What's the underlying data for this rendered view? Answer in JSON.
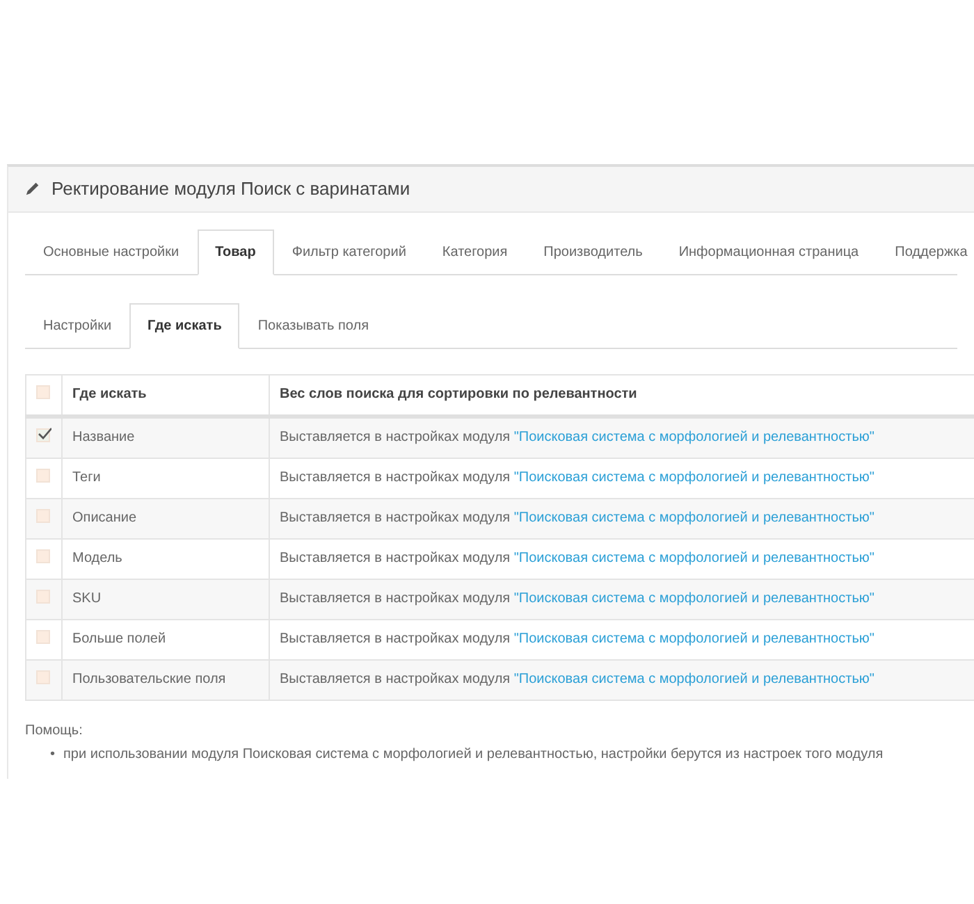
{
  "panel": {
    "title": "Ректирование модуля Поиск с варинатами"
  },
  "tabs": [
    {
      "label": "Основные настройки",
      "selected": false
    },
    {
      "label": "Товар",
      "selected": true
    },
    {
      "label": "Фильтр категорий",
      "selected": false
    },
    {
      "label": "Категория",
      "selected": false
    },
    {
      "label": "Производитель",
      "selected": false
    },
    {
      "label": "Информационная страница",
      "selected": false
    },
    {
      "label": "Поддержка",
      "selected": false
    }
  ],
  "subtabs": [
    {
      "label": "Настройки",
      "selected": false
    },
    {
      "label": "Где искать",
      "selected": true
    },
    {
      "label": "Показывать поля",
      "selected": false
    }
  ],
  "table": {
    "header_checked": false,
    "columns": [
      "Где искать",
      "Вес слов поиска для сортировки по релевантности"
    ],
    "rows": [
      {
        "checked": true,
        "name": "Название",
        "weight_text": "Выставляется в настройках модуля",
        "weight_link": "\"Поисковая система с морфологией и релевантностью\""
      },
      {
        "checked": false,
        "name": "Теги",
        "weight_text": "Выставляется в настройках модуля",
        "weight_link": "\"Поисковая система с морфологией и релевантностью\""
      },
      {
        "checked": false,
        "name": "Описание",
        "weight_text": "Выставляется в настройках модуля",
        "weight_link": "\"Поисковая система с морфологией и релевантностью\""
      },
      {
        "checked": false,
        "name": "Модель",
        "weight_text": "Выставляется в настройках модуля",
        "weight_link": "\"Поисковая система с морфологией и релевантностью\""
      },
      {
        "checked": false,
        "name": "SKU",
        "weight_text": "Выставляется в настройках модуля",
        "weight_link": "\"Поисковая система с морфологией и релевантностью\""
      },
      {
        "checked": false,
        "name": "Больше полей",
        "weight_text": "Выставляется в настройках модуля",
        "weight_link": "\"Поисковая система с морфологией и релевантностью\""
      },
      {
        "checked": false,
        "name": "Пользовательские поля",
        "weight_text": "Выставляется в настройках модуля",
        "weight_link": "\"Поисковая система с морфологией и релевантностью\""
      }
    ]
  },
  "help": {
    "title": "Помощь:",
    "bullet": "•",
    "items": [
      "при использовании модуля Поисковая система с морфологией и релевантностью, настройки берутся из настроек того модуля"
    ]
  }
}
